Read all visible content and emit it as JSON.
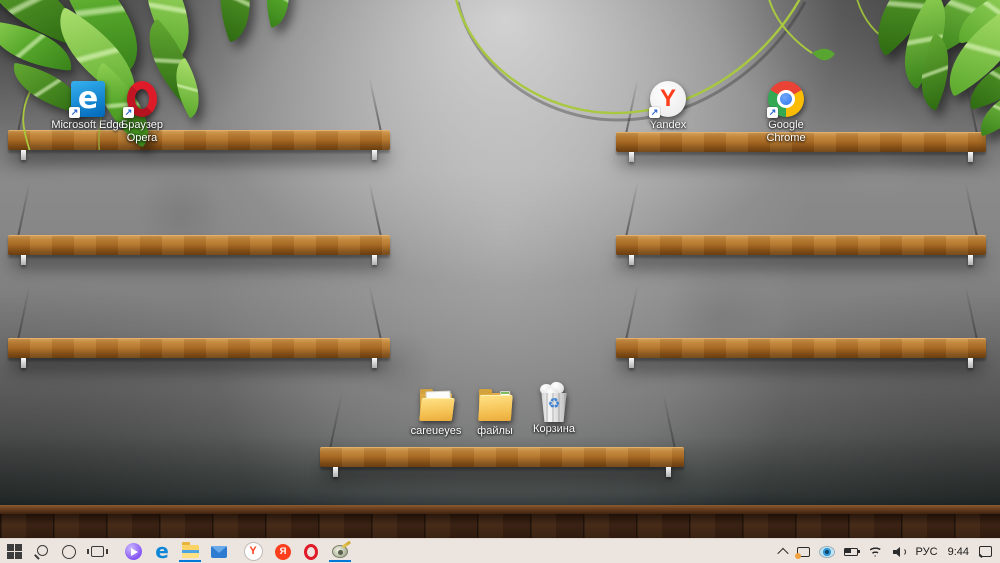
{
  "wallpaper": {
    "description": "gray concrete wall lit by a top spotlight, wooden wall shelves on cables, green vine leaves in top corners, dark wooden plank floor"
  },
  "shortcut_arrow": "↗",
  "desktop_icons": [
    {
      "label": "Microsoft Edge",
      "kind": "shortcut",
      "glyph": "e"
    },
    {
      "label": "Браузер Opera",
      "kind": "shortcut"
    },
    {
      "label": "Yandex",
      "kind": "shortcut",
      "glyph": "Y"
    },
    {
      "label": "Google Chrome",
      "kind": "shortcut"
    },
    {
      "label": "careueyes",
      "kind": "folder"
    },
    {
      "label": "файлы",
      "kind": "folder"
    },
    {
      "label": "Корзина",
      "kind": "recycle-bin-full",
      "glyph": "♻"
    }
  ],
  "taskbar": {
    "buttons": [
      {
        "name": "start"
      },
      {
        "name": "search"
      },
      {
        "name": "cortana"
      },
      {
        "name": "task-view"
      },
      {
        "name": "alice"
      },
      {
        "name": "edge",
        "glyph": "e"
      },
      {
        "name": "file-explorer",
        "open": true
      },
      {
        "name": "mail"
      },
      {
        "name": "yandex-browser",
        "glyph": "Y"
      },
      {
        "name": "yandex",
        "glyph": "Я"
      },
      {
        "name": "opera"
      },
      {
        "name": "careueyes",
        "open": true
      }
    ],
    "tray": {
      "language": "РУС",
      "time": "9:44"
    }
  },
  "colors": {
    "accent": "#0078d7",
    "taskbar_bg": "#ece4de",
    "shelf_wood": "#b07128",
    "wall_mid": "#828282",
    "floor": "#2a1810",
    "leaf_green": "#56a72b"
  }
}
